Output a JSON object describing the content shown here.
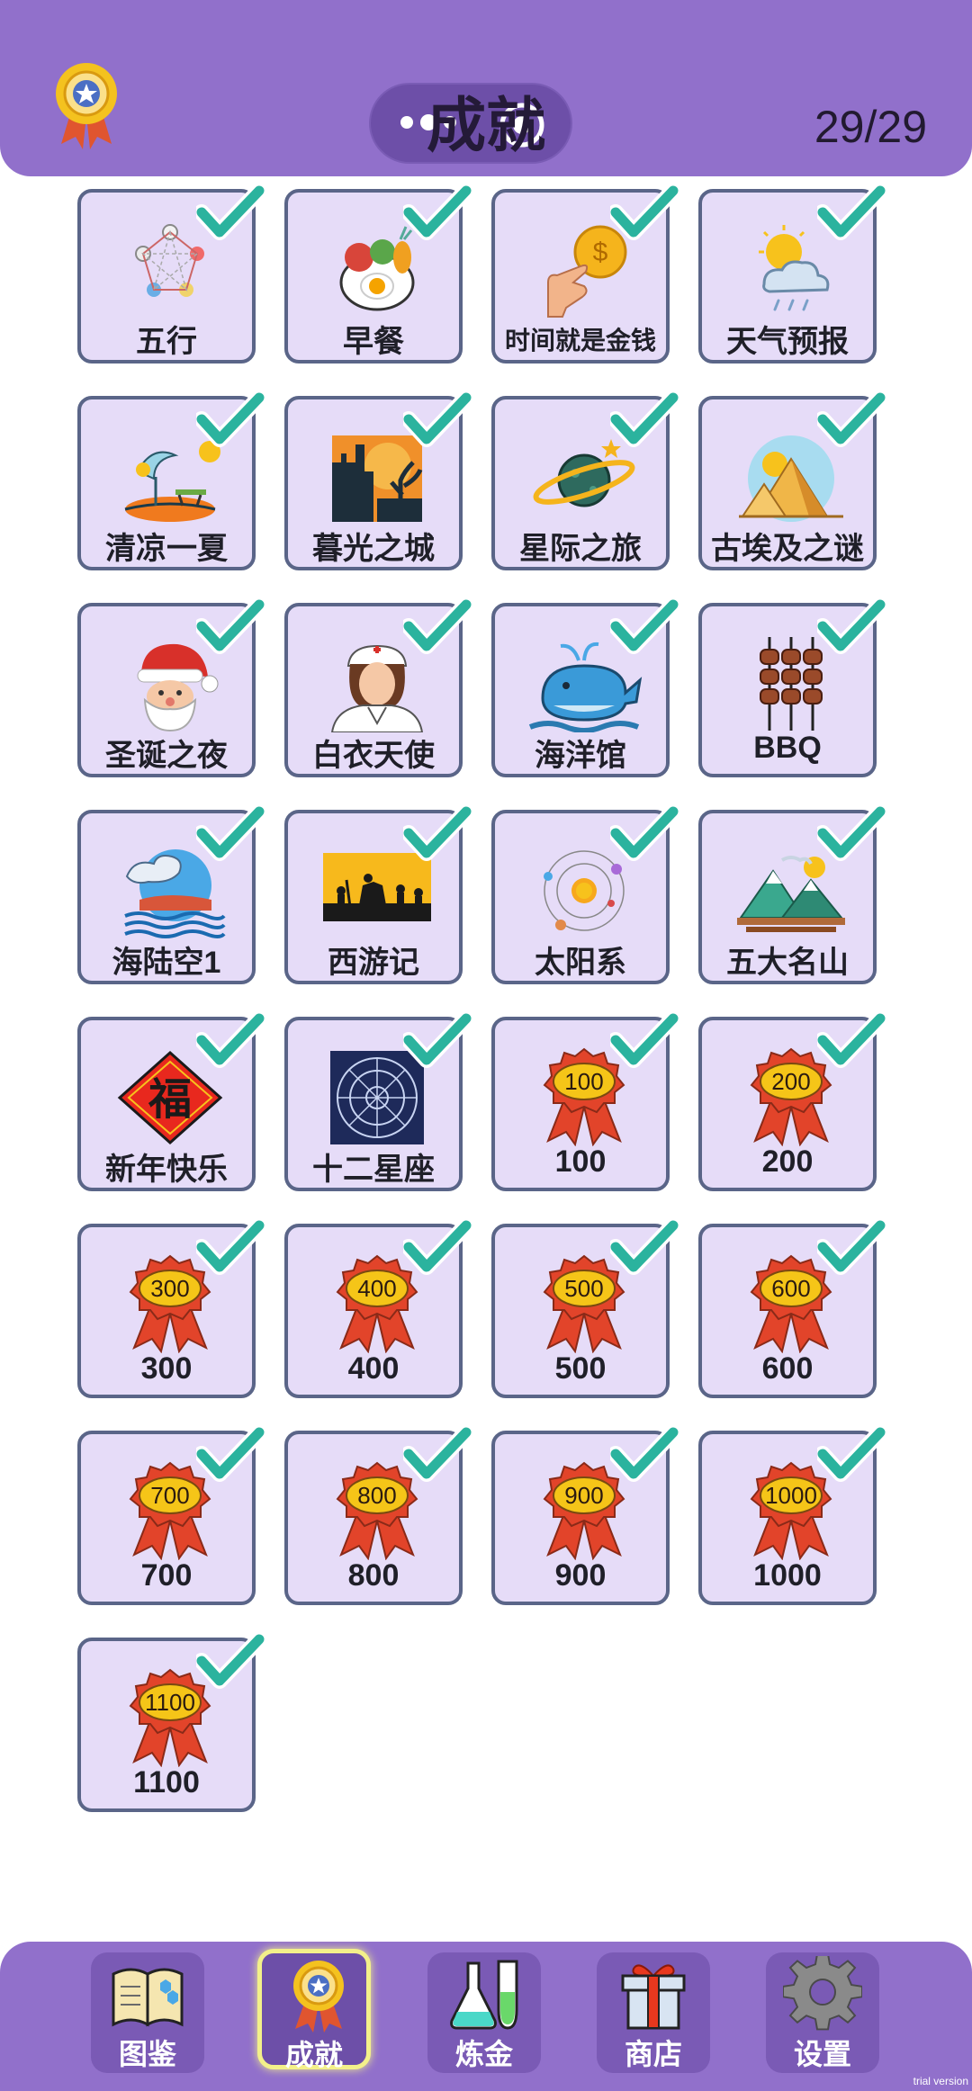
{
  "header": {
    "title": "成就",
    "counter": "29/29",
    "badge_icon": "achievement-medal-icon"
  },
  "achievements": [
    {
      "label": "五行",
      "icon": "five-elements-icon",
      "completed": true
    },
    {
      "label": "早餐",
      "icon": "breakfast-icon",
      "completed": true
    },
    {
      "label": "时间就是金钱",
      "icon": "time-is-money-icon",
      "completed": true
    },
    {
      "label": "天气预报",
      "icon": "weather-icon",
      "completed": true
    },
    {
      "label": "清凉一夏",
      "icon": "summer-beach-icon",
      "completed": true
    },
    {
      "label": "暮光之城",
      "icon": "twilight-castle-icon",
      "completed": true
    },
    {
      "label": "星际之旅",
      "icon": "planet-icon",
      "completed": true
    },
    {
      "label": "古埃及之谜",
      "icon": "pyramid-icon",
      "completed": true
    },
    {
      "label": "圣诞之夜",
      "icon": "santa-icon",
      "completed": true
    },
    {
      "label": "白衣天使",
      "icon": "nurse-icon",
      "completed": true
    },
    {
      "label": "海洋馆",
      "icon": "whale-icon",
      "completed": true
    },
    {
      "label": "BBQ",
      "icon": "skewers-icon",
      "completed": true
    },
    {
      "label": "海陆空1",
      "icon": "sea-land-air-icon",
      "completed": true
    },
    {
      "label": "西游记",
      "icon": "journey-west-icon",
      "completed": true
    },
    {
      "label": "太阳系",
      "icon": "solar-system-icon",
      "completed": true
    },
    {
      "label": "五大名山",
      "icon": "mountains-icon",
      "completed": true
    },
    {
      "label": "新年快乐",
      "icon": "fu-new-year-icon",
      "completed": true
    },
    {
      "label": "十二星座",
      "icon": "zodiac-icon",
      "completed": true
    },
    {
      "label": "100",
      "icon": "rosette-icon",
      "badge": "100",
      "completed": true
    },
    {
      "label": "200",
      "icon": "rosette-icon",
      "badge": "200",
      "completed": true
    },
    {
      "label": "300",
      "icon": "rosette-icon",
      "badge": "300",
      "completed": true
    },
    {
      "label": "400",
      "icon": "rosette-icon",
      "badge": "400",
      "completed": true
    },
    {
      "label": "500",
      "icon": "rosette-icon",
      "badge": "500",
      "completed": true
    },
    {
      "label": "600",
      "icon": "rosette-icon",
      "badge": "600",
      "completed": true
    },
    {
      "label": "700",
      "icon": "rosette-icon",
      "badge": "700",
      "completed": true
    },
    {
      "label": "800",
      "icon": "rosette-icon",
      "badge": "800",
      "completed": true
    },
    {
      "label": "900",
      "icon": "rosette-icon",
      "badge": "900",
      "completed": true
    },
    {
      "label": "1000",
      "icon": "rosette-icon",
      "badge": "1000",
      "completed": true
    },
    {
      "label": "1100",
      "icon": "rosette-icon",
      "badge": "1100",
      "completed": true
    }
  ],
  "nav": [
    {
      "label": "图鉴",
      "icon": "book-icon",
      "active": false
    },
    {
      "label": "成就",
      "icon": "medal-icon",
      "active": true
    },
    {
      "label": "炼金",
      "icon": "flask-icon",
      "active": false
    },
    {
      "label": "商店",
      "icon": "gift-icon",
      "active": false
    },
    {
      "label": "设置",
      "icon": "gear-icon",
      "active": false
    }
  ],
  "watermark": "trial version",
  "colors": {
    "header_bg": "#9170cb",
    "card_bg": "#e6dcf8",
    "card_border": "#5a6588",
    "check": "#2bb39e",
    "rosette": "#e2442a",
    "badge_gold": "#f5c518",
    "nav_active_glow": "#f3f08a"
  }
}
